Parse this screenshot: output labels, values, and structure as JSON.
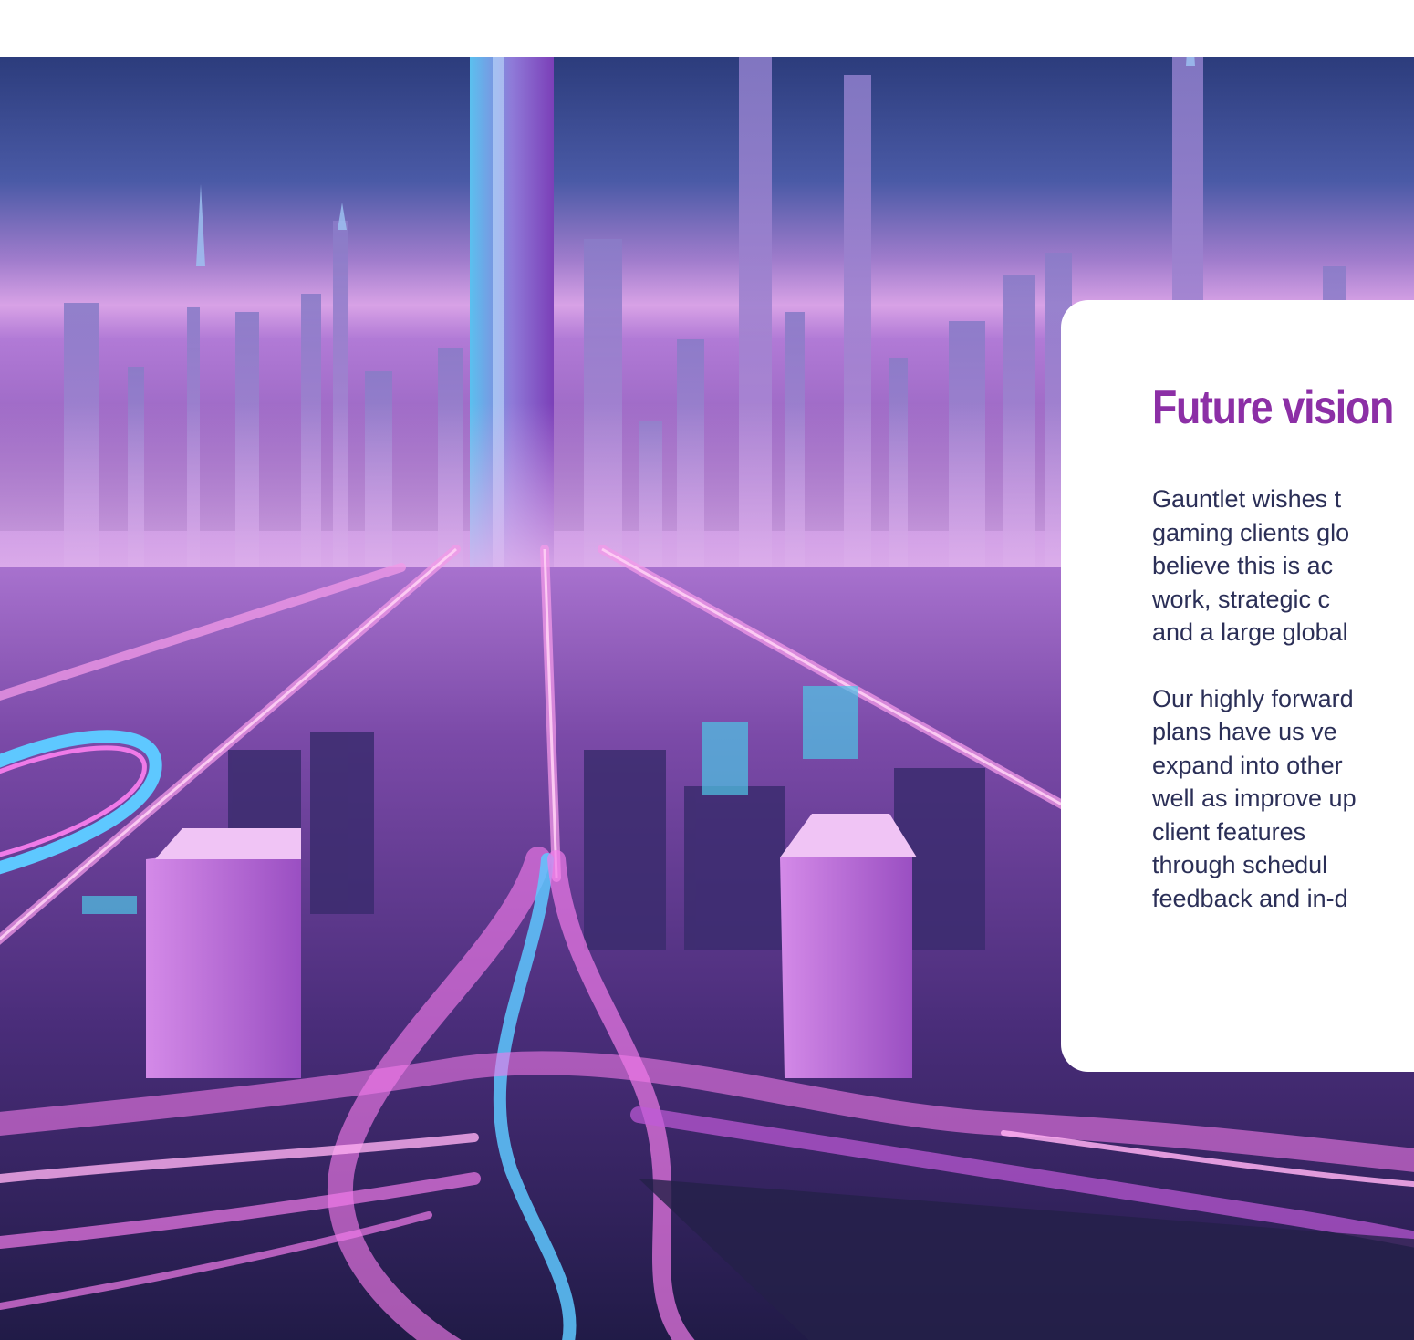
{
  "hero": {
    "image_subject": "futuristic-neon-city-highway"
  },
  "card": {
    "title": "Future vision",
    "paragraphs": [
      [
        "Gauntlet wishes t",
        "gaming clients glo",
        "believe this is ac",
        "work, strategic c",
        "and a large global"
      ],
      [
        "Our highly forward",
        "plans have us ve",
        "expand into other",
        "well as improve up",
        "client features",
        "through schedul",
        "feedback and in-d"
      ]
    ]
  },
  "colors": {
    "title": "#8c2fa6",
    "body_text": "#2b2f57",
    "card_bg": "#ffffff",
    "sky_top": "#2e3f7e",
    "neon_pink": "#f07ae8",
    "neon_blue": "#5ec8ff"
  }
}
